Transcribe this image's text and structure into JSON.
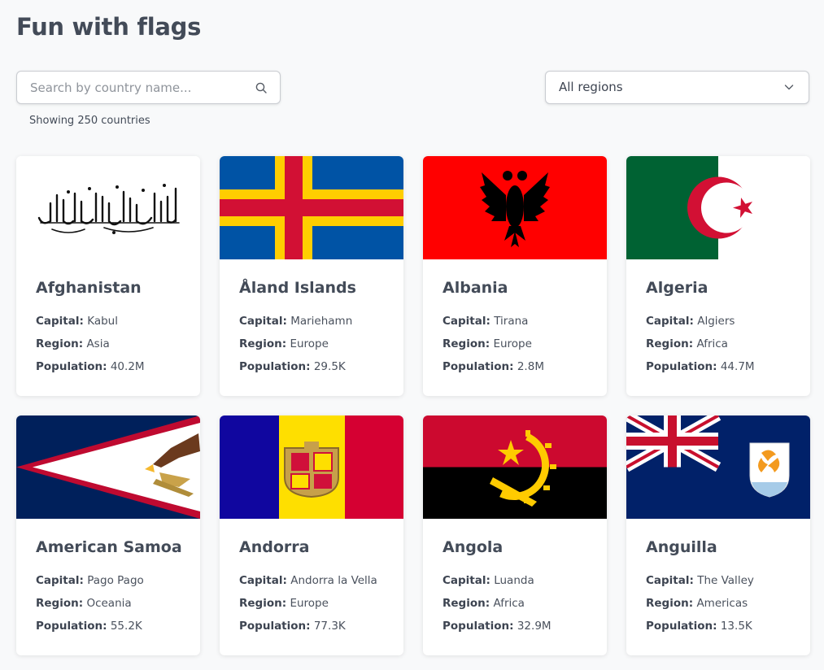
{
  "page": {
    "title": "Fun with flags"
  },
  "search": {
    "placeholder": "Search by country name...",
    "value": ""
  },
  "filter": {
    "selected": "All regions"
  },
  "results": {
    "count_text": "Showing 250 countries"
  },
  "labels": {
    "capital": "Capital:",
    "region": "Region:",
    "population": "Population:"
  },
  "countries": [
    {
      "name": "Afghanistan",
      "capital": "Kabul",
      "region": "Asia",
      "population": "40.2M",
      "flag": "afghanistan-flag"
    },
    {
      "name": "Åland Islands",
      "capital": "Mariehamn",
      "region": "Europe",
      "population": "29.5K",
      "flag": "aland-flag"
    },
    {
      "name": "Albania",
      "capital": "Tirana",
      "region": "Europe",
      "population": "2.8M",
      "flag": "albania-flag"
    },
    {
      "name": "Algeria",
      "capital": "Algiers",
      "region": "Africa",
      "population": "44.7M",
      "flag": "algeria-flag"
    },
    {
      "name": "American Samoa",
      "capital": "Pago Pago",
      "region": "Oceania",
      "population": "55.2K",
      "flag": "american-samoa-flag"
    },
    {
      "name": "Andorra",
      "capital": "Andorra la Vella",
      "region": "Europe",
      "population": "77.3K",
      "flag": "andorra-flag"
    },
    {
      "name": "Angola",
      "capital": "Luanda",
      "region": "Africa",
      "population": "32.9M",
      "flag": "angola-flag"
    },
    {
      "name": "Anguilla",
      "capital": "The Valley",
      "region": "Americas",
      "population": "13.5K",
      "flag": "anguilla-flag"
    }
  ]
}
